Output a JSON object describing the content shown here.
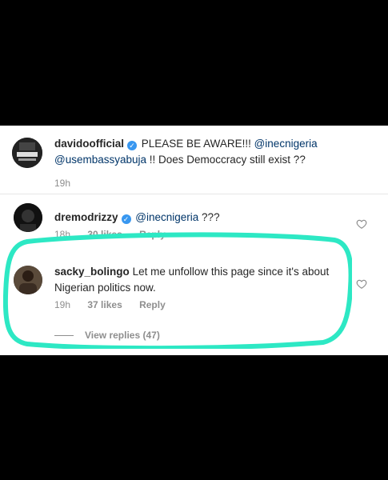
{
  "comments": [
    {
      "username": "davidoofficial",
      "text_prefix": "PLEASE BE AWARE!!! ",
      "mention1": "@inecnigeria",
      "mention2": "@usembassyabuja",
      "text_suffix": " !! Does Democcracy still exist ??",
      "time": "19h"
    },
    {
      "username": "dremodrizzy",
      "mention1": "@inecnigeria",
      "text_suffix": " ???",
      "time": "18h",
      "likes": "30 likes",
      "reply": "Reply"
    },
    {
      "username": "sacky_bolingo",
      "text": "Let me unfollow this page since it's about Nigerian politics now.",
      "time": "19h",
      "likes": "37 likes",
      "reply": "Reply",
      "view_replies": "View replies (47)"
    }
  ],
  "colors": {
    "highlight": "#2de8c4",
    "verified": "#3897f0"
  },
  "icons": [
    "verified-badge-icon",
    "heart-icon"
  ]
}
